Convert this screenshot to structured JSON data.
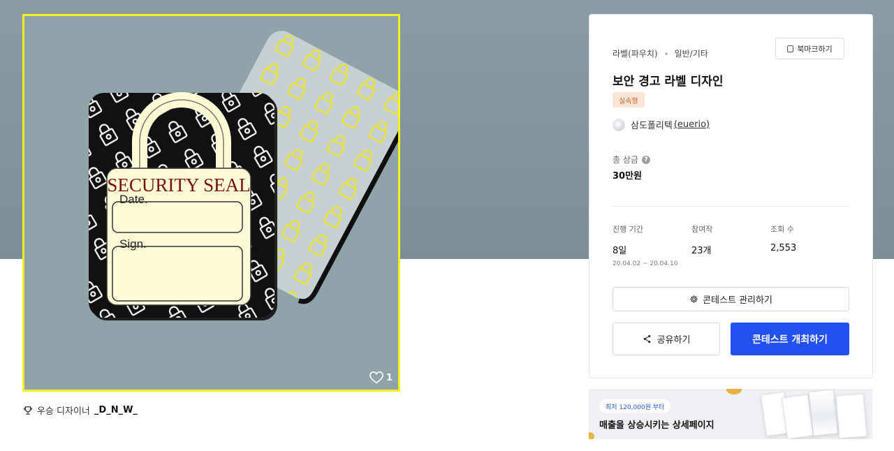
{
  "contest": {
    "category": "라벨(파우치)",
    "subcategory": "일반/기타",
    "bookmark_label": "북마크하기",
    "title": "보안 경고 라벨 디자인",
    "badge": "실속형",
    "organizer": "삼도폴리텍",
    "organizer_handle": "(euerio)",
    "prize_label": "총 상금",
    "prize_help": "?",
    "prize_value": "30만원",
    "stats": {
      "period_label": "진행 기간",
      "period_value": "8일",
      "period_range": "20.04.02 ~ 20.04.10",
      "participants_label": "참여작",
      "participants_value": "23개",
      "views_label": "조회 수",
      "views_value": "2,553"
    },
    "manage_label": "콘테스트 관리하기",
    "share_label": "공유하기",
    "host_label": "콘테스트 개최하기"
  },
  "artwork": {
    "seal_title": "SECURITY SEAL",
    "date_label": "Date.",
    "sign_label": "Sign.",
    "like_count": "1"
  },
  "winner": {
    "label": "우승 디자이너",
    "name": "_D_N_W_"
  },
  "ad": {
    "pill": "최저 120,000원 부터",
    "text": "매출을 상승시키는 상세페이지"
  },
  "colors": {
    "primary": "#2251f0",
    "highlight_border": "#f3f21c",
    "badge_bg": "#fbe5d6",
    "badge_text": "#d0652a",
    "seal_title": "#7a0f12"
  },
  "icons": [
    "bookmark-icon",
    "help-icon",
    "gear-icon",
    "share-icon",
    "heart-icon",
    "trophy-icon",
    "padlock-icon"
  ]
}
